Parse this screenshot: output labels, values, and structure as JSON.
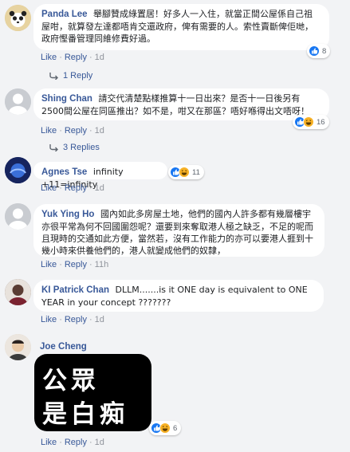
{
  "labels": {
    "like": "Like",
    "reply": "Reply",
    "sep": "·"
  },
  "comments": [
    {
      "author": "Panda Lee",
      "text": "舉腳贊成綠置居！好多人一入住，就當正間公屋係自己祖屋咁，就算發左達都唔肯交還政府，俾有需要的人。索性賣斷俾佢哋，政府慳番管理同維修費好過。",
      "time": "1d",
      "reaction_count": "8",
      "reactions": [
        "like"
      ]
    },
    {
      "author": "Shing Chan",
      "text": "請交代清楚點樣推算十一日出來？是否十一日後另有2500間公屋在同區推出？如不是，咁又在那區？唔好喺得出文唔呀！",
      "time": "1d",
      "reaction_count": "16",
      "reactions": [
        "like",
        "haha"
      ]
    },
    {
      "author": "Agnes Tse",
      "text": "infinity +11=infinity",
      "time": "1d",
      "reaction_count": "11",
      "reactions": [
        "like",
        "haha"
      ]
    },
    {
      "author": "Yuk Ying Ho",
      "text": "國內如此多房屋土地，他們的國內人許多都有幾層樓宇亦很平常為何不回國圍怨呢？還要到來奪取港人極之缺乏，不足的呢而且現時的交通如此方便，當然若，沒有工作能力的亦可以要港人捱到十幾小時來供養他們的，港人就變成他們的奴隸，",
      "time": "11h"
    },
    {
      "author": "KI Patrick Chan",
      "text": "DLLM.......is it ONE day is equivalent to ONE YEAR in your concept ???????",
      "time": "1d"
    },
    {
      "author": "Joe Cheng",
      "text": "",
      "time": "1d",
      "reaction_count": "6",
      "reactions": [
        "like",
        "haha"
      ],
      "image_text": [
        "公眾",
        "是白痴"
      ]
    }
  ],
  "reply_links": [
    "1 Reply",
    "3 Replies"
  ],
  "colors": {
    "link": "#385898",
    "bubble": "#ffffff",
    "background": "#f2f3f5",
    "like": "#1877f2",
    "haha": "#f7b125"
  }
}
